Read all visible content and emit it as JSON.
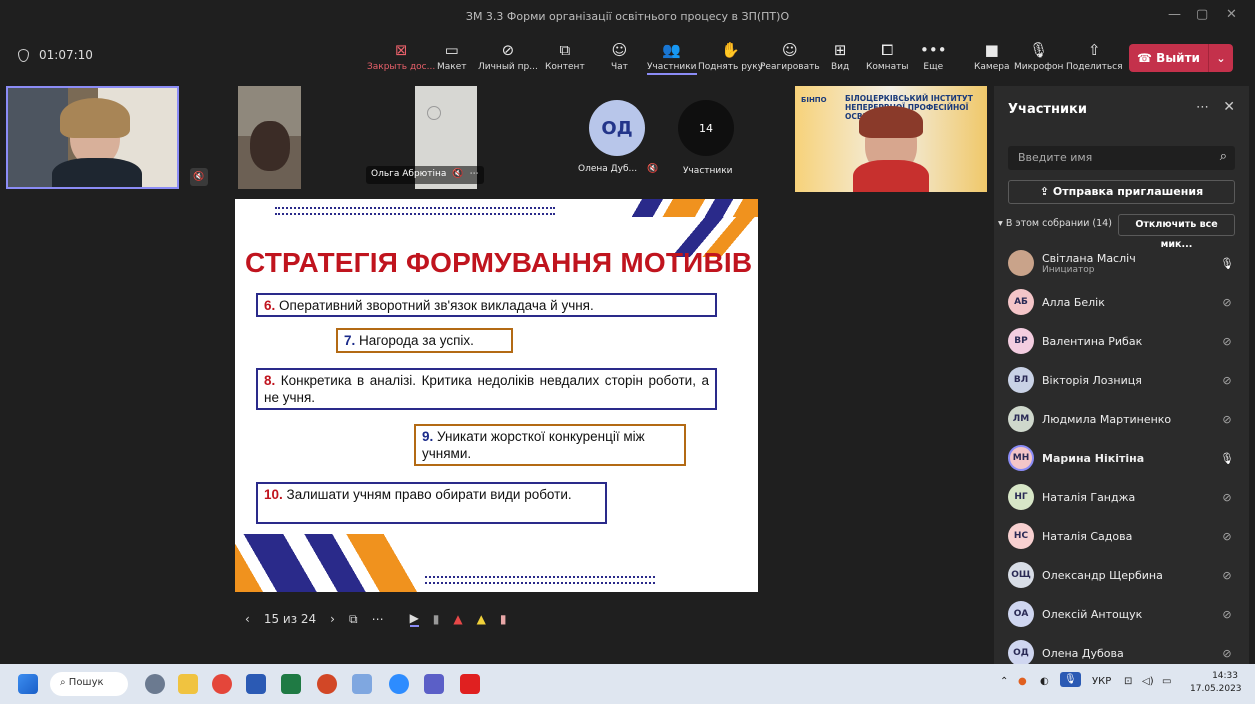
{
  "window": {
    "title": "ЗМ 3.3 Форми організації освітнього процесу в ЗП(ПТ)О"
  },
  "meeting": {
    "timer": "01:07:10"
  },
  "toolbar": {
    "items": [
      {
        "label": "Закрыть дос...",
        "icon": "close-share-icon",
        "glyph": "⊠"
      },
      {
        "label": "Макет",
        "icon": "layout-icon",
        "glyph": "▭"
      },
      {
        "label": "Личный пр...",
        "icon": "private-view-icon",
        "glyph": "⊘"
      },
      {
        "label": "Контент",
        "icon": "content-icon",
        "glyph": "⧉"
      },
      {
        "label": "Чат",
        "icon": "chat-icon",
        "glyph": "☺"
      },
      {
        "label": "Участники",
        "icon": "participants-icon",
        "glyph": "👥"
      },
      {
        "label": "Поднять руку",
        "icon": "raise-hand-icon",
        "glyph": "✋"
      },
      {
        "label": "Реагировать",
        "icon": "react-icon",
        "glyph": "☺"
      },
      {
        "label": "Вид",
        "icon": "view-icon",
        "glyph": "⊞"
      },
      {
        "label": "Комнаты",
        "icon": "rooms-icon",
        "glyph": "⧠"
      },
      {
        "label": "Еще",
        "icon": "more-icon",
        "glyph": "•••"
      },
      {
        "label": "Камера",
        "icon": "camera-icon",
        "glyph": "■"
      },
      {
        "label": "Микрофон",
        "icon": "microphone-icon",
        "glyph": "🎙"
      },
      {
        "label": "Поделиться",
        "icon": "share-icon",
        "glyph": "⇧"
      }
    ],
    "leave_label": "Выйти"
  },
  "stage": {
    "tile_olga_name": "Ольга Абрютіна",
    "od_initials": "ОД",
    "od_name": "Олена Дуб...",
    "participants_count": "14",
    "participants_label": "Участники",
    "banner_line1": "БІЛОЦЕРКІВСЬКИЙ ІНСТИТУТ",
    "banner_line2": "НЕПЕРЕРВНОЇ ПРОФЕСІЙНОЇ ОСВІТИ",
    "banner_logo": "БІНПО"
  },
  "slide": {
    "heading": "СТРАТЕГІЯ ФОРМУВАННЯ МОТИВІВ",
    "items": [
      {
        "num": "6.",
        "text": "Оперативний зворотний зв'язок викладача й учня."
      },
      {
        "num": "7.",
        "text": "Нагорода за успіх."
      },
      {
        "num": "8.",
        "text": "Конкретика в аналізі. Критика недоліків невдалих сторін роботи, а не учня."
      },
      {
        "num": "9.",
        "text": "Уникати жорсткої конкуренції між учнями."
      },
      {
        "num": "10.",
        "text": "Залишати учням право обирати види роботи."
      }
    ]
  },
  "slide_nav": {
    "page": "15 из 24"
  },
  "panel": {
    "title": "Участники",
    "search_placeholder": "Введите имя",
    "invite_label": "Отправка приглашения",
    "in_meeting": "В этом собрании (14)",
    "mute_all": "Отключить все мик...",
    "participants": [
      {
        "initials": "",
        "name": "Світлана Масліч",
        "role": "Инициатор",
        "mic": "on",
        "color": "#c9a38a"
      },
      {
        "initials": "АБ",
        "name": "Алла Белік",
        "role": "",
        "mic": "off",
        "color": "#f4c5c8"
      },
      {
        "initials": "ВР",
        "name": "Валентина Рибак",
        "role": "",
        "mic": "off",
        "color": "#f3cde0"
      },
      {
        "initials": "ВЛ",
        "name": "Вікторія Лозниця",
        "role": "",
        "mic": "off",
        "color": "#c9d2e6"
      },
      {
        "initials": "ЛМ",
        "name": "Людмила Мартиненко",
        "role": "",
        "mic": "off",
        "color": "#cfd8cc"
      },
      {
        "initials": "МН",
        "name": "Марина Нікітіна",
        "role": "",
        "mic": "on",
        "color": "#f4c5c8"
      },
      {
        "initials": "НГ",
        "name": "Наталія Ганджа",
        "role": "",
        "mic": "off",
        "color": "#d7e6c7"
      },
      {
        "initials": "НС",
        "name": "Наталія Садова",
        "role": "",
        "mic": "off",
        "color": "#f7d0d0"
      },
      {
        "initials": "ОЩ",
        "name": "Олександр Щербина",
        "role": "",
        "mic": "off",
        "color": "#d8dde6"
      },
      {
        "initials": "ОА",
        "name": "Олексій Антощук",
        "role": "",
        "mic": "off",
        "color": "#cfd6f0"
      },
      {
        "initials": "ОД",
        "name": "Олена Дубова",
        "role": "",
        "mic": "off",
        "color": "#cfd6f0"
      }
    ]
  },
  "taskbar": {
    "search_label": "Пошук",
    "lang": "УКР",
    "time": "14:33",
    "date": "17.05.2023"
  }
}
